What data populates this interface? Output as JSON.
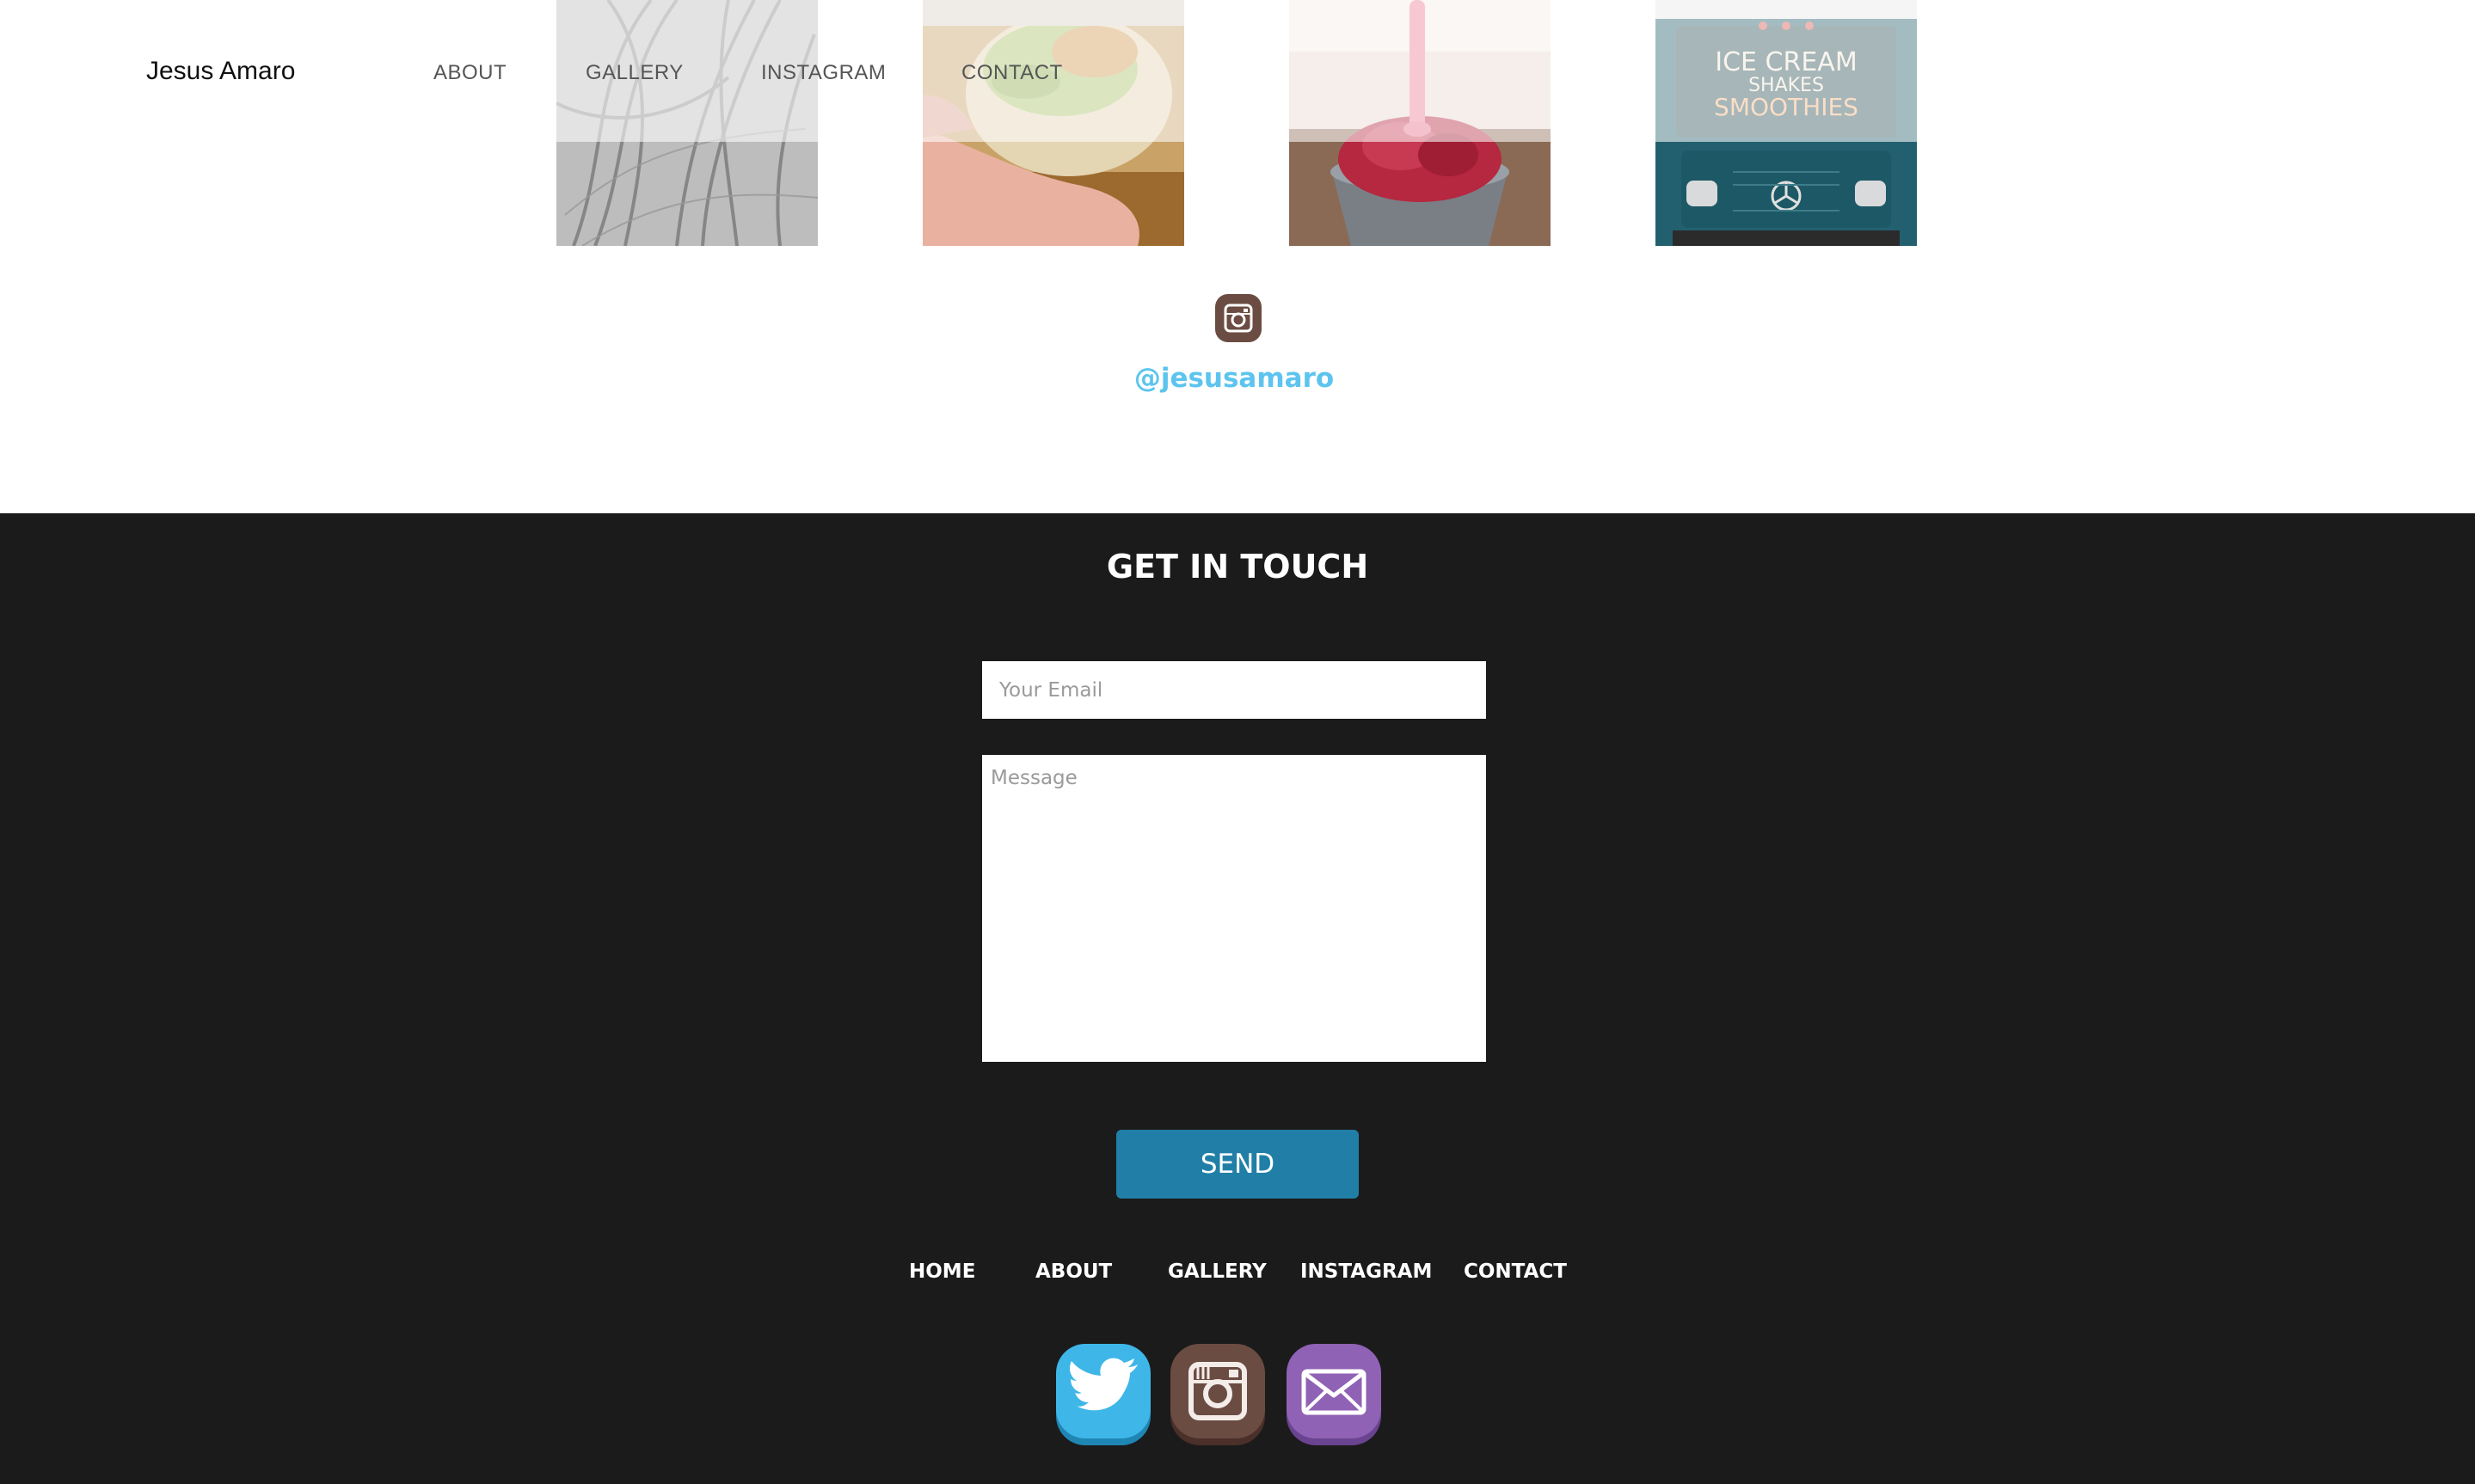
{
  "header": {
    "brand": "Jesus Amaro",
    "nav": [
      "ABOUT",
      "GALLERY",
      "INSTAGRAM",
      "CONTACT"
    ]
  },
  "instagram": {
    "photos": [
      "tire-tracks-photo",
      "wrap-sandwich-photo",
      "red-gelato-cup-photo",
      "ice-cream-truck-photo"
    ],
    "truck_sign": [
      "ICE CREAM",
      "SHAKES",
      "SMOOTHIES"
    ],
    "handle": "@jesusamaro"
  },
  "contact": {
    "title": "GET IN TOUCH",
    "email_placeholder": "Your Email",
    "message_placeholder": "Message",
    "send_label": "SEND"
  },
  "footer": {
    "nav": [
      "HOME",
      "ABOUT",
      "GALLERY",
      "INSTAGRAM",
      "CONTACT"
    ],
    "social_icons": [
      "twitter-icon",
      "instagram-icon",
      "mail-icon"
    ]
  },
  "colors": {
    "handle": "#5cc4ee",
    "dark_background": "#1b1b1b",
    "send_button": "#217fa7",
    "twitter": "#3fb6e8",
    "instagram": "#6b4c43",
    "mail": "#8f62b5"
  }
}
